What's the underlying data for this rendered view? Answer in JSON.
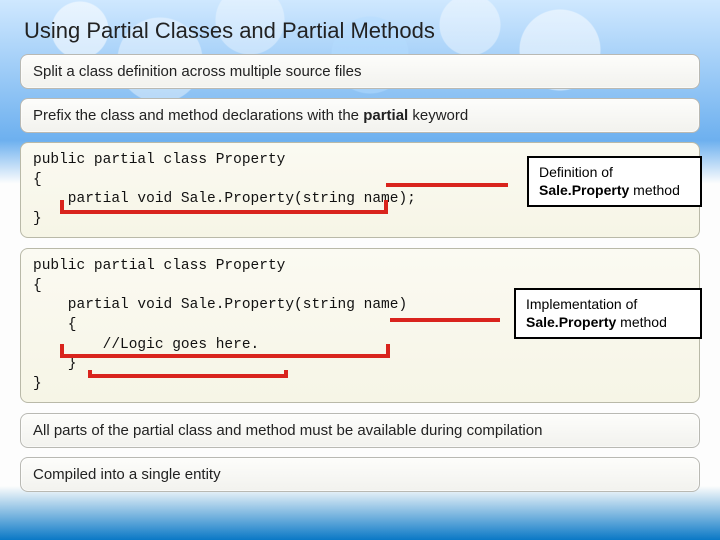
{
  "title": "Using Partial Classes and Partial Methods",
  "bullets": {
    "b1": "Split a class definition across multiple source files",
    "b2_pre": "Prefix the class and method declarations with the ",
    "b2_kw": "partial",
    "b2_post": " keyword",
    "b3": "All parts of the partial class and method must be available during compilation",
    "b4": "Compiled into a single entity"
  },
  "code1": "public partial class Property\n{\n    partial void Sale.Property(string name);\n}",
  "code2": "public partial class Property\n{\n    partial void Sale.Property(string name)\n    {\n        //Logic goes here.\n    }\n}",
  "callouts": {
    "c1_pre": "Definition of ",
    "c1_b": "Sale.Property",
    "c1_post": " method",
    "c2_pre": "Implementation of ",
    "c2_b": "Sale.Property",
    "c2_post": " method"
  }
}
